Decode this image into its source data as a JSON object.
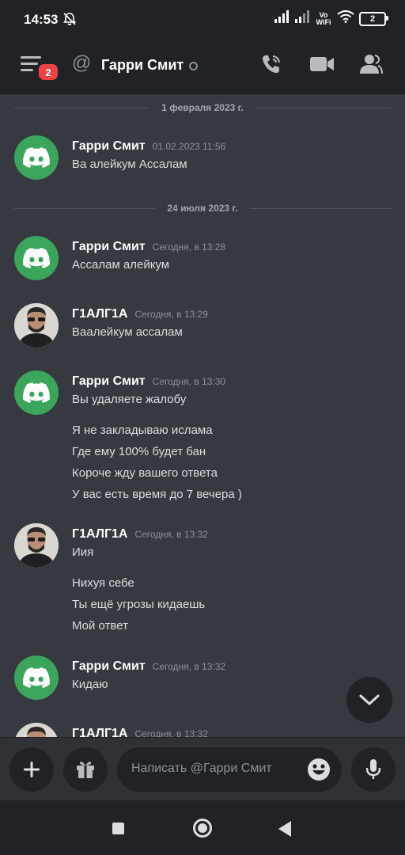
{
  "status_bar": {
    "time": "14:53",
    "network": "Vo WiFi",
    "battery": "2"
  },
  "header": {
    "dm_name": "Гарри Смит",
    "notifications_badge": "2"
  },
  "dividers": [
    "1 февраля 2023 г.",
    "24 июля 2023 г."
  ],
  "messages": [
    {
      "author": "Гарри Смит",
      "timestamp": "01.02.2023 11:56",
      "lines": [
        "Ва алейкум Ассалам"
      ]
    },
    {
      "author": "Гарри Смит",
      "timestamp": "Сегодня, в 13:28",
      "lines": [
        "Ассалам алейкум"
      ]
    },
    {
      "author": "Г1АЛГ1А",
      "timestamp": "Сегодня, в 13:29",
      "lines": [
        "Ваалейкум ассалам"
      ]
    },
    {
      "author": "Гарри Смит",
      "timestamp": "Сегодня, в 13:30",
      "lines": [
        "Вы удаляете жалобу",
        "Я не закладываю ислама",
        "Где ему 100% будет бан",
        "Короче жду вашего ответа",
        "У вас есть время до 7 вечера )"
      ]
    },
    {
      "author": "Г1АЛГ1А",
      "timestamp": "Сегодня, в 13:32",
      "lines": [
        "Иия",
        "Нихуя себе",
        "Ты ещё угрозы кидаешь",
        "Мой ответ"
      ]
    },
    {
      "author": "Гарри Смит",
      "timestamp": "Сегодня, в 13:32",
      "lines": [
        "Кидаю"
      ]
    },
    {
      "author": "Г1АЛГ1А",
      "timestamp": "Сегодня, в 13:32",
      "lines": []
    }
  ],
  "composer": {
    "placeholder": "Написать @Гарри Смит"
  },
  "colors": {
    "background": "#36393f",
    "header": "#202225",
    "accent_green": "#3ba55c",
    "badge_red": "#ed4245"
  }
}
